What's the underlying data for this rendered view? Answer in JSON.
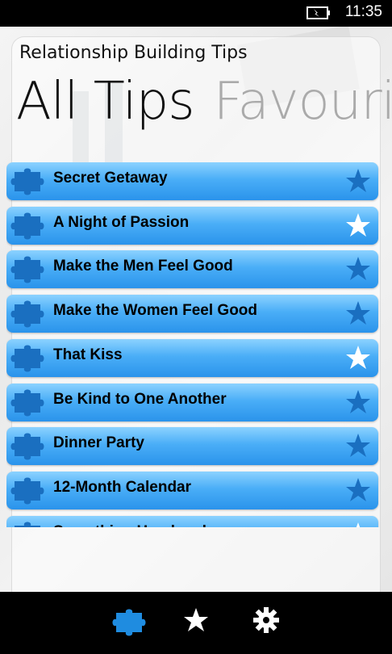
{
  "status": {
    "time": "11:35",
    "battery_icon": "battery-charging-icon"
  },
  "app": {
    "title": "Relationship Building Tips"
  },
  "pivot": {
    "active": "All Tips",
    "inactive": "Favouri"
  },
  "colors": {
    "row_top": "#8cd2ff",
    "row_bottom": "#2a93eb",
    "star_fav": "#ffffff",
    "star_normal": "#1a6fc0",
    "appbar_piece": "#1f8ce0"
  },
  "tips": [
    {
      "label": "Secret Getaway",
      "favourite": false
    },
    {
      "label": "A Night of Passion",
      "favourite": true
    },
    {
      "label": "Make the Men Feel Good",
      "favourite": false
    },
    {
      "label": "Make the Women Feel Good",
      "favourite": false
    },
    {
      "label": "That Kiss",
      "favourite": true
    },
    {
      "label": "Be Kind to One Another",
      "favourite": false
    },
    {
      "label": "Dinner Party",
      "favourite": false
    },
    {
      "label": "12-Month Calendar",
      "favourite": false
    },
    {
      "label": "Something Handmade",
      "favourite": true
    }
  ],
  "app_bar": [
    {
      "name": "all-tips-button",
      "icon": "puzzle-piece-icon"
    },
    {
      "name": "favourites-button",
      "icon": "star-icon"
    },
    {
      "name": "settings-button",
      "icon": "gear-icon"
    }
  ]
}
